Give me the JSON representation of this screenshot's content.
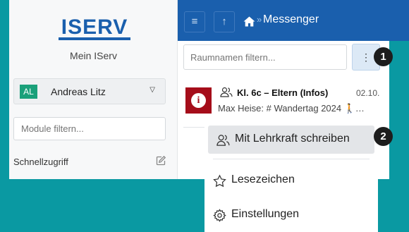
{
  "sidebar": {
    "logo_text": "ISERV",
    "mein_label": "Mein IServ",
    "user": {
      "initials": "AL",
      "name": "Andreas Litz",
      "avatar_color": "#1aa07a"
    },
    "module_search_placeholder": "Module filtern...",
    "quick_access_label": "Schnellzugriff"
  },
  "topbar": {
    "menu_icon": "hamburger-icon",
    "up_icon": "arrow-up-icon",
    "breadcrumb_separator": "»",
    "breadcrumb": "Messenger",
    "color": "#1a5fad"
  },
  "main": {
    "room_search_placeholder": "Raumnamen filtern...",
    "kebab_label": "⋮",
    "chat": {
      "title": "Kl. 6c – Eltern (Infos)",
      "date": "02.10.",
      "preview": "Max Heise: # Wandertag 2024 🚶…",
      "thumb_label": "i"
    }
  },
  "dropdown": {
    "items": [
      {
        "label": "Mit Lehrkraft schreiben",
        "icon": "users-icon"
      },
      {
        "label": "Lesezeichen",
        "icon": "star-icon"
      },
      {
        "label": "Einstellungen",
        "icon": "gear-icon"
      }
    ]
  },
  "callouts": [
    "1",
    "2"
  ],
  "colors": {
    "background": "#0a99a2",
    "accent": "#1a5fad",
    "callout": "#1d1d1d"
  }
}
